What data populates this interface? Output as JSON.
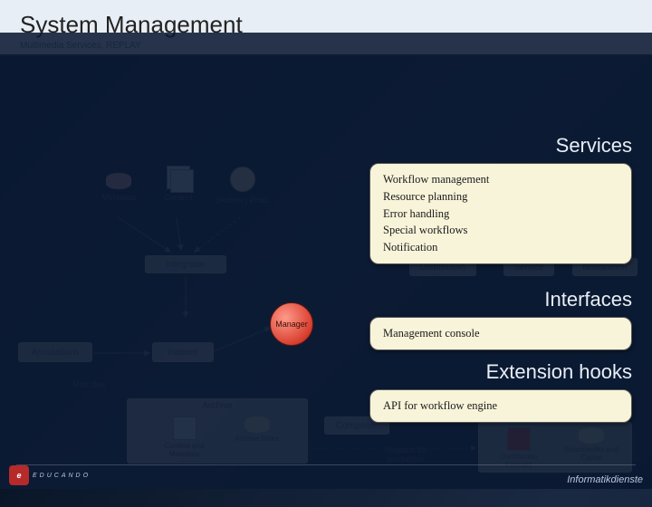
{
  "header": {
    "title": "System Management",
    "subtitle": "Multimedia Services, REPLAY"
  },
  "sections": {
    "services": "Services",
    "interfaces": "Interfaces",
    "extension": "Extension hooks"
  },
  "services_list": [
    "Workflow management",
    "Resource planning",
    "Error handling",
    "Special workflows",
    "Notification"
  ],
  "interfaces_list": [
    "Management console"
  ],
  "extension_list": [
    "API for workflow engine"
  ],
  "diagram": {
    "metadata": "Metadata",
    "content": "Content",
    "autom_prod": "(Autom.) Prod.",
    "integrator": "Integrator",
    "manager": "Manager",
    "annotations": "Annotations",
    "indexer": "Indexer",
    "reindex": "Reindex",
    "archive": "Archive",
    "content_metadata": "Content and Metadata",
    "archive_index": "Archive Index",
    "composer": "Composer",
    "request_prod": "Request for production",
    "distribution": "Distribution",
    "service": "Service",
    "notification2": "Notification",
    "dist_formats": "Distribution Formats",
    "search_cache": "Searchindex and Cache"
  },
  "footer": {
    "left_brand": "EDUCANDO",
    "right_brand": "Informatikdienste"
  }
}
